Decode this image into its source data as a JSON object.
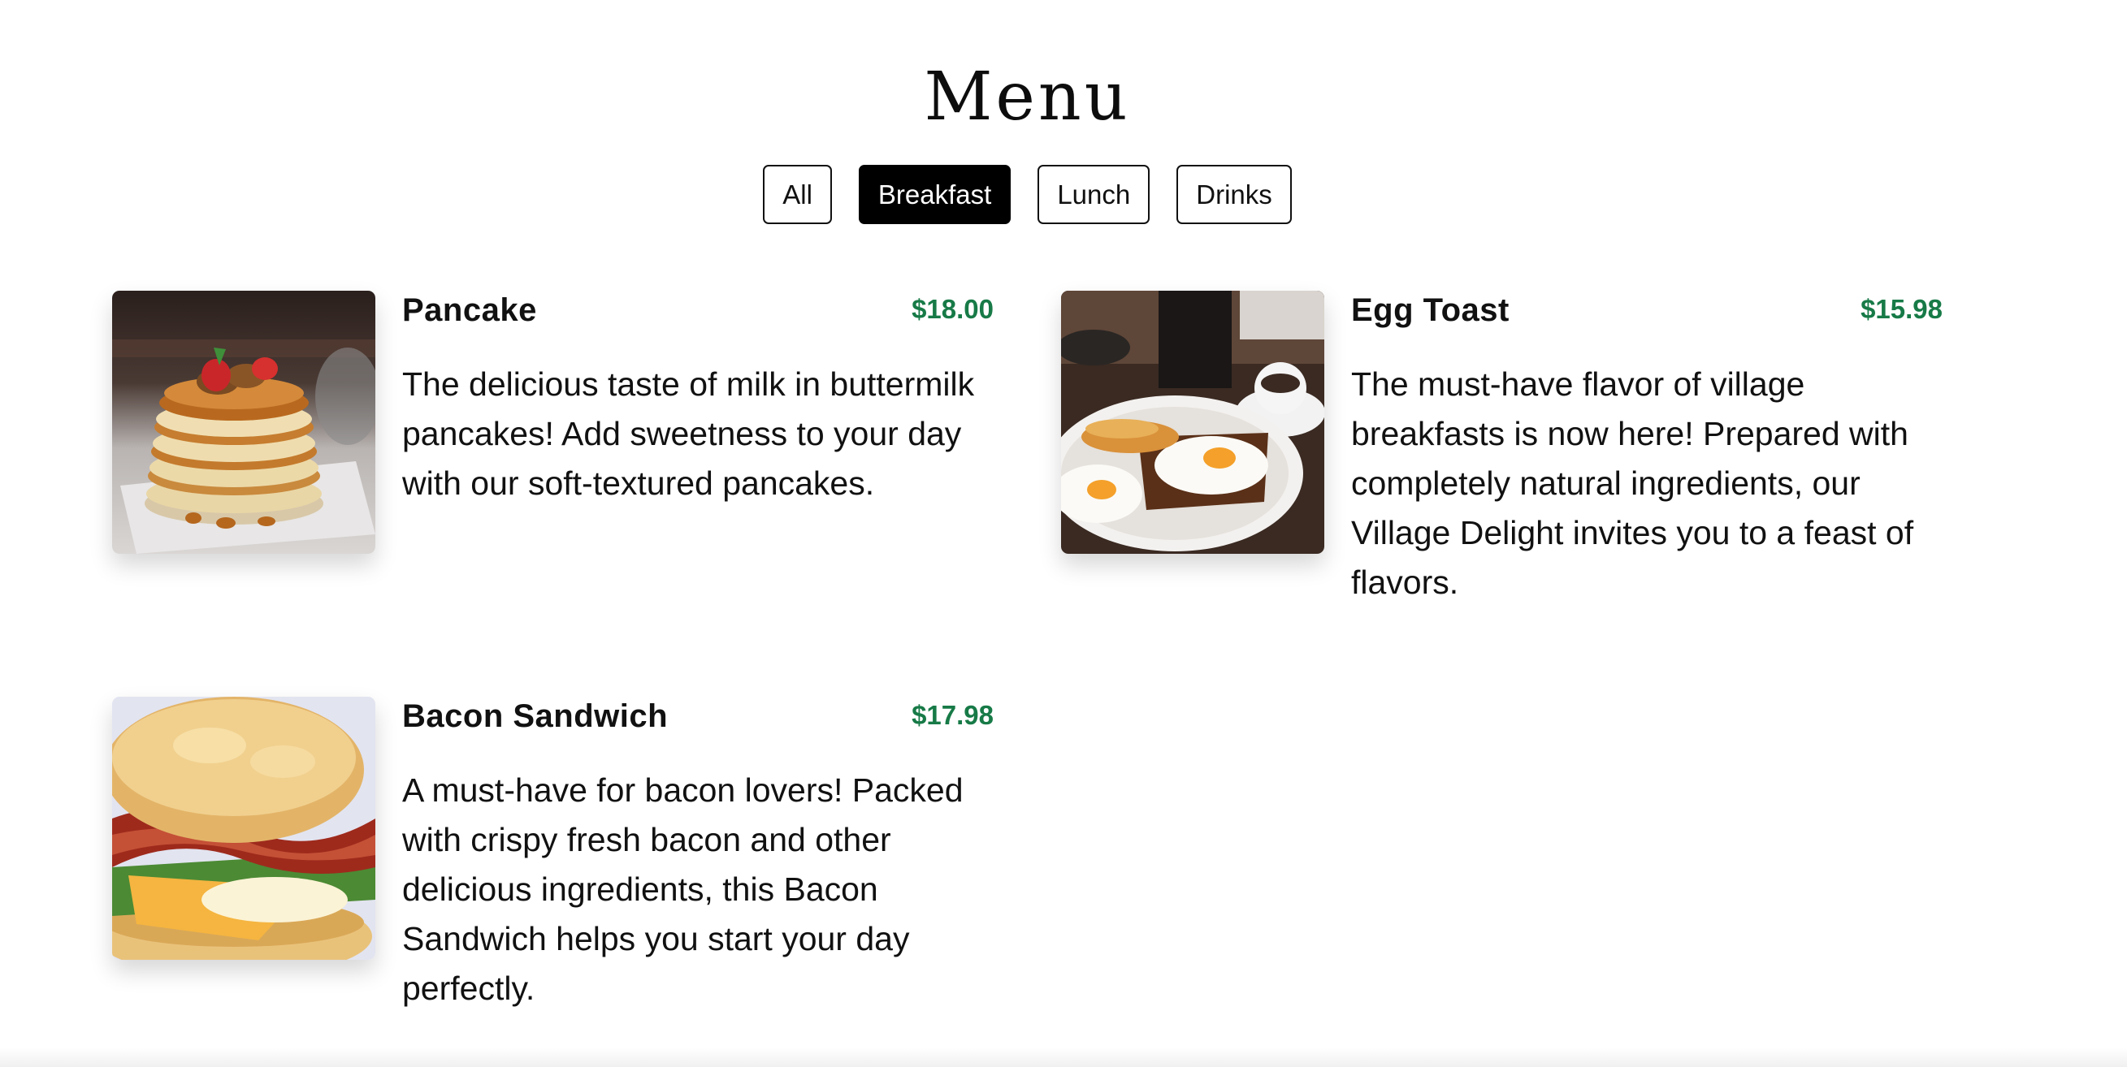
{
  "menu": {
    "title": "Menu"
  },
  "filters": [
    {
      "label": "All",
      "active": false
    },
    {
      "label": "Breakfast",
      "active": true
    },
    {
      "label": "Lunch",
      "active": false
    },
    {
      "label": "Drinks",
      "active": false
    }
  ],
  "items": [
    {
      "name": "Pancake",
      "price": "$18.00",
      "description": "The delicious taste of milk in buttermilk pancakes! Add sweetness to your day with our soft-textured pancakes."
    },
    {
      "name": "Egg Toast",
      "price": "$15.98",
      "description": "The must-have flavor of village breakfasts is now here! Prepared with completely natural ingredients, our Village Delight invites you to a feast of flavors."
    },
    {
      "name": "Bacon Sandwich",
      "price": "$17.98",
      "description": "A must-have for bacon lovers! Packed with crispy fresh bacon and other delicious ingredients, this Bacon Sandwich helps you start your day perfectly."
    }
  ],
  "colors": {
    "price": "#177a47",
    "active_filter_bg": "#000000",
    "active_filter_text": "#ffffff"
  }
}
